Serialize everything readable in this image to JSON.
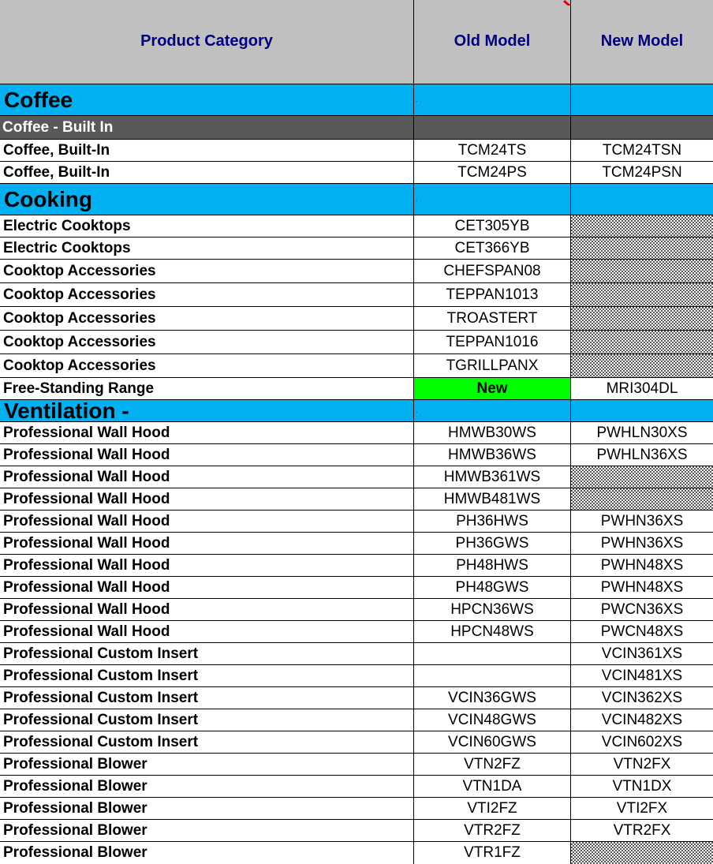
{
  "headers": {
    "category": "Product Category",
    "old_model": "Old Model",
    "new_model": "New Model"
  },
  "sections": {
    "coffee": "Coffee",
    "coffee_built_in": "Coffee - Built In",
    "cooking": "Cooking",
    "ventilation": "Ventilation -"
  },
  "section_dot": ".",
  "new_tag": "New",
  "colors": {
    "header_bg": "#c0c0c0",
    "header_text": "#000080",
    "section_bg": "#00b0f0",
    "subsection_bg": "#595959",
    "new_highlight": "#00ff00"
  },
  "rows": [
    {
      "category": "Coffee, Built-In",
      "old": "TCM24TS",
      "new": "TCM24TSN"
    },
    {
      "category": "Coffee, Built-In",
      "old": "TCM24PS",
      "new": "TCM24PSN"
    },
    {
      "category": "Electric Cooktops",
      "old": "CET305YB",
      "new": ""
    },
    {
      "category": "Electric Cooktops",
      "old": "CET366YB",
      "new": ""
    },
    {
      "category": "Cooktop Accessories",
      "old": "CHEFSPAN08",
      "new": ""
    },
    {
      "category": "Cooktop Accessories",
      "old": "TEPPAN1013",
      "new": ""
    },
    {
      "category": "Cooktop Accessories",
      "old": "TROASTERT",
      "new": ""
    },
    {
      "category": "Cooktop Accessories",
      "old": "TEPPAN1016",
      "new": ""
    },
    {
      "category": "Cooktop Accessories",
      "old": "TGRILLPANX",
      "new": ""
    },
    {
      "category": "Free-Standing Range",
      "old": "New",
      "new": "MRI304DL"
    },
    {
      "category": "Professional Wall Hood",
      "old": "HMWB30WS",
      "new": "PWHLN30XS"
    },
    {
      "category": "Professional Wall Hood",
      "old": "HMWB36WS",
      "new": "PWHLN36XS"
    },
    {
      "category": "Professional Wall Hood",
      "old": "HMWB361WS",
      "new": ""
    },
    {
      "category": "Professional Wall Hood",
      "old": "HMWB481WS",
      "new": ""
    },
    {
      "category": "Professional Wall Hood",
      "old": "PH36HWS",
      "new": "PWHN36XS"
    },
    {
      "category": "Professional Wall Hood",
      "old": "PH36GWS",
      "new": "PWHN36XS"
    },
    {
      "category": "Professional Wall Hood",
      "old": "PH48HWS",
      "new": "PWHN48XS"
    },
    {
      "category": "Professional Wall Hood",
      "old": "PH48GWS",
      "new": "PWHN48XS"
    },
    {
      "category": "Professional Wall Hood",
      "old": "HPCN36WS",
      "new": "PWCN36XS"
    },
    {
      "category": "Professional Wall Hood",
      "old": "HPCN48WS",
      "new": "PWCN48XS"
    },
    {
      "category": "Professional Custom Insert",
      "old": "",
      "new": "VCIN361XS"
    },
    {
      "category": "Professional Custom Insert",
      "old": "",
      "new": "VCIN481XS"
    },
    {
      "category": "Professional Custom Insert",
      "old": "VCIN36GWS",
      "new": "VCIN362XS"
    },
    {
      "category": "Professional Custom Insert",
      "old": "VCIN48GWS",
      "new": "VCIN482XS"
    },
    {
      "category": "Professional Custom Insert",
      "old": "VCIN60GWS",
      "new": "VCIN602XS"
    },
    {
      "category": "Professional Blower",
      "old": "VTN2FZ",
      "new": "VTN2FX"
    },
    {
      "category": "Professional Blower",
      "old": "VTN1DA",
      "new": "VTN1DX"
    },
    {
      "category": "Professional Blower",
      "old": "VTI2FZ",
      "new": "VTI2FX"
    },
    {
      "category": "Professional Blower",
      "old": "VTR2FZ",
      "new": "VTR2FX"
    },
    {
      "category": "Professional Blower",
      "old": "VTR1FZ",
      "new": ""
    }
  ]
}
